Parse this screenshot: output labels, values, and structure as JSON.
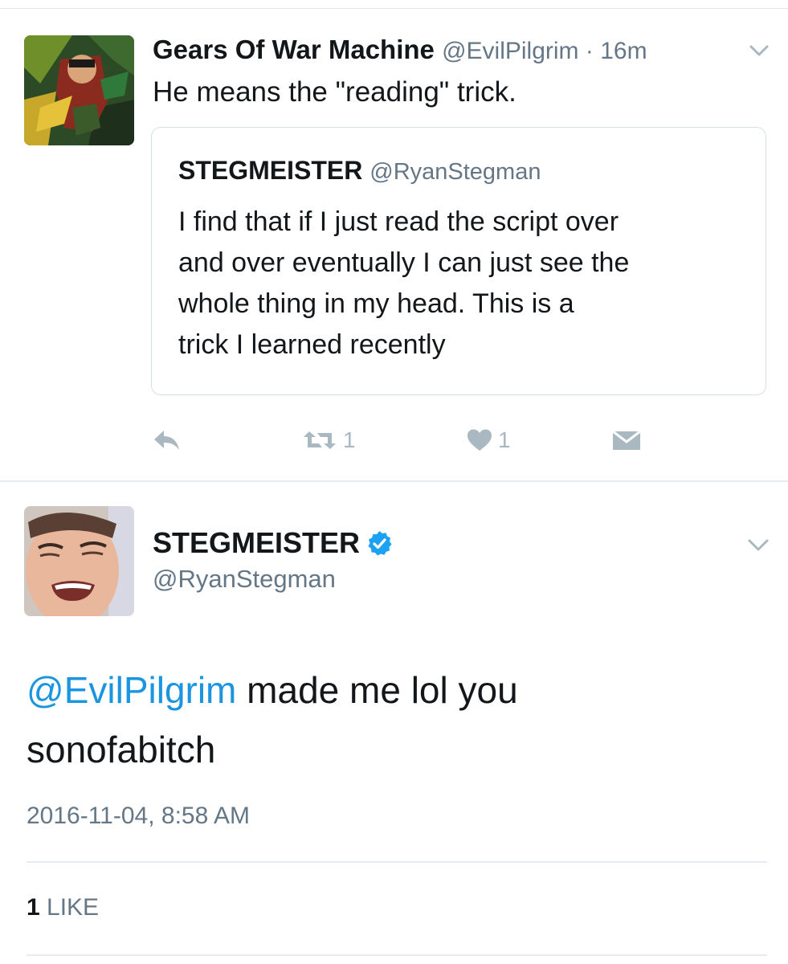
{
  "tweet": {
    "author_name": "Gears Of War Machine",
    "author_handle": "@EvilPilgrim",
    "separator": " · ",
    "time": "16m",
    "text": "He means the \"reading\" trick.",
    "quote": {
      "author_name": "STEGMEISTER",
      "author_handle": "@RyanStegman",
      "lines": [
        "I find that if I just read the script over",
        "and over eventually I can just see the",
        "whole thing in my head. This is a",
        "trick I learned recently"
      ]
    },
    "actions": {
      "retweet_count": "1",
      "like_count": "1"
    }
  },
  "reply": {
    "author_name": "STEGMEISTER",
    "author_handle": "@RyanStegman",
    "mention": "@EvilPilgrim",
    "text_line1": " made me lol you",
    "text_line2": "sonofabitch",
    "timestamp": "2016-11-04, 8:58 AM",
    "likes_count": "1",
    "likes_label": " LIKE"
  },
  "colors": {
    "link": "#1b95e0",
    "muted": "#657786",
    "icon": "#aab8c2",
    "verified": "#1da1f2"
  },
  "icons": {
    "reply": "reply-icon",
    "retweet": "retweet-icon",
    "like": "heart-icon",
    "dm": "envelope-icon",
    "menu": "chevron-down-icon",
    "verified": "verified-badge-icon"
  }
}
